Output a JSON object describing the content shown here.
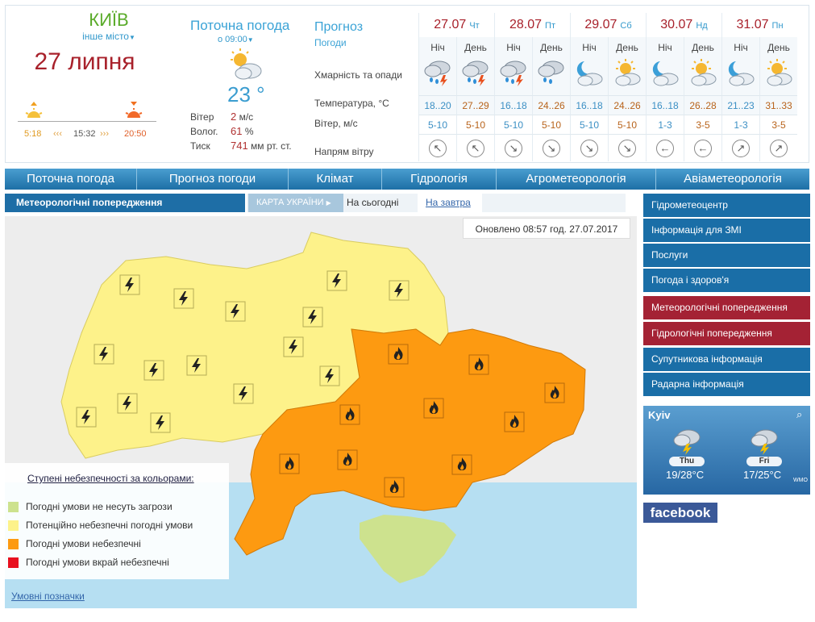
{
  "location": {
    "city": "КИЇВ",
    "other_city": "інше місто",
    "date": "27 липня",
    "sunrise": "5:18",
    "day_length": "15:32",
    "sunset": "20:50"
  },
  "current": {
    "title": "Поточна погода",
    "time": "о 09:00",
    "temp": "23 °",
    "wind_label": "Вітер",
    "wind_value": "2",
    "wind_unit": "м/с",
    "humidity_label": "Волог.",
    "humidity_value": "61",
    "humidity_unit": "%",
    "pressure_label": "Тиск",
    "pressure_value": "741",
    "pressure_unit": "мм рт. ст."
  },
  "forecast": {
    "title": "Прогноз",
    "subtitle": "Погоди",
    "row_clouds": "Хмарність та опади",
    "row_temp": "Температура, °C",
    "row_wind": "Вітер, м/с",
    "row_dir": "Напрям вітру",
    "days": [
      {
        "date": "27.07",
        "dow": "Чт"
      },
      {
        "date": "28.07",
        "dow": "Пт"
      },
      {
        "date": "29.07",
        "dow": "Сб"
      },
      {
        "date": "30.07",
        "dow": "Нд"
      },
      {
        "date": "31.07",
        "dow": "Пн"
      }
    ],
    "slots": [
      {
        "label": "Ніч",
        "temp": "18..20",
        "wind": "5-10",
        "dir": "↖",
        "icon": "cloud-rain-storm-icon"
      },
      {
        "label": "День",
        "temp": "27..29",
        "wind": "5-10",
        "dir": "↖",
        "icon": "cloud-rain-storm-icon"
      },
      {
        "label": "Ніч",
        "temp": "16..18",
        "wind": "5-10",
        "dir": "↘",
        "icon": "cloud-rain-storm-icon"
      },
      {
        "label": "День",
        "temp": "24..26",
        "wind": "5-10",
        "dir": "↘",
        "icon": "cloud-rain-icon"
      },
      {
        "label": "Ніч",
        "temp": "16..18",
        "wind": "5-10",
        "dir": "↘",
        "icon": "moon-cloud-icon"
      },
      {
        "label": "День",
        "temp": "24..26",
        "wind": "5-10",
        "dir": "↘",
        "icon": "sun-cloud-icon"
      },
      {
        "label": "Ніч",
        "temp": "16..18",
        "wind": "1-3",
        "dir": "←",
        "icon": "moon-cloud-icon"
      },
      {
        "label": "День",
        "temp": "26..28",
        "wind": "3-5",
        "dir": "←",
        "icon": "sun-cloud-icon"
      },
      {
        "label": "Ніч",
        "temp": "21..23",
        "wind": "1-3",
        "dir": "↗",
        "icon": "moon-cloud-icon"
      },
      {
        "label": "День",
        "temp": "31..33",
        "wind": "3-5",
        "dir": "↗",
        "icon": "sun-cloud-icon"
      }
    ]
  },
  "nav": {
    "items": [
      "Поточна погода",
      "Прогноз погоди",
      "Клімат",
      "Гідрологія",
      "Агрометеорологія",
      "Авіаметеорологія"
    ]
  },
  "subtabs": {
    "main": "Метеорологічні попередження",
    "map": "КАРТА УКРАЇНИ",
    "today": "На сьогодні",
    "tomorrow": "На завтра"
  },
  "map": {
    "updated": "Оновлено 08:57 год. 27.07.2017",
    "colors": {
      "yellow": "#fdf28a",
      "orange": "#fd9a11",
      "green": "#cde28e",
      "water": "#b6dff2",
      "land": "#ededed"
    }
  },
  "legend": {
    "title": "Ступені небезпечності за кольорами:",
    "items": [
      {
        "label": "Погодні умови не несуть загрози",
        "color": "#cde28e"
      },
      {
        "label": "Потенційно небезпечні погодні умови",
        "color": "#fdf28a"
      },
      {
        "label": "Погодні умови небезпечні",
        "color": "#fd9a11"
      },
      {
        "label": "Погодні умови вкрай небезпечні",
        "color": "#e8101e"
      }
    ],
    "link": "Умовні позначки"
  },
  "sidebar": {
    "items": [
      {
        "label": "Гідрометеоцентр",
        "style": "blue"
      },
      {
        "label": "Інформація для ЗМІ",
        "style": "blue"
      },
      {
        "label": "Послуги",
        "style": "blue"
      },
      {
        "label": "Погода і здоров'я",
        "style": "blue"
      },
      {
        "label": "Метеорологічні попередження",
        "style": "red"
      },
      {
        "label": "Гідрологічні попередження",
        "style": "red"
      },
      {
        "label": "Супутникова інформація",
        "style": "blue"
      },
      {
        "label": "Радарна інформація",
        "style": "blue"
      }
    ]
  },
  "widget": {
    "city": "Kyiv",
    "day1": "Thu",
    "day1_temp": "19/28°C",
    "day2": "Fri",
    "day2_temp": "17/25°C",
    "logo": "WMO"
  },
  "facebook": {
    "label": "facebook"
  }
}
